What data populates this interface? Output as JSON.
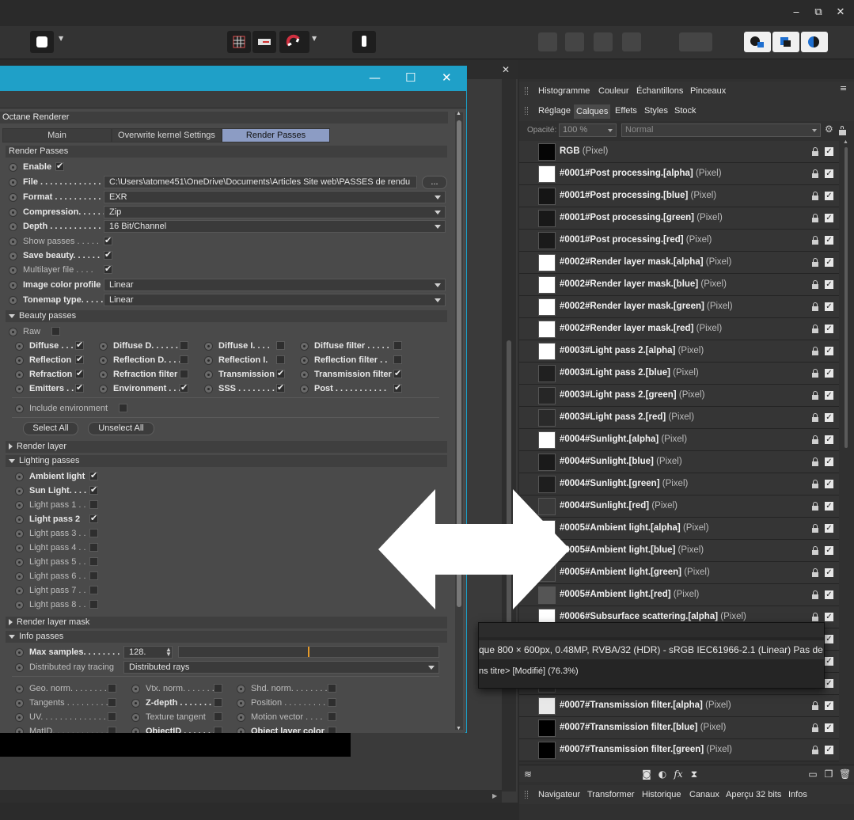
{
  "window": {
    "minimize": "‒",
    "restore": "⧉",
    "close": "✕"
  },
  "plugin_window": {
    "minimize": "—",
    "maximize": "☐",
    "close": "✕",
    "section_title": "Octane Renderer",
    "tabs": [
      "Main",
      "Overwrite kernel Settings",
      "Render Passes"
    ],
    "active_tab": "Render Passes",
    "render_passes_header": "Render Passes",
    "enable": {
      "label": "Enable",
      "checked": true
    },
    "file": {
      "label": "File . . . . . . . . . . . . .",
      "value": "C:\\Users\\atome451\\OneDrive\\Documents\\Articles Site web\\PASSES de rendu",
      "browse": "..."
    },
    "format": {
      "label": "Format . . . . . . . . . .",
      "value": "EXR"
    },
    "compression": {
      "label": "Compression. . . . . . .",
      "value": "Zip"
    },
    "depth": {
      "label": "Depth . . . . . . . . . . .",
      "value": "16 Bit/Channel"
    },
    "show_passes": {
      "label": "Show passes . . . . .",
      "checked": true
    },
    "save_beauty": {
      "label": "Save beauty. . . . . .",
      "checked": true
    },
    "multilayer_file": {
      "label": "Multilayer file . . . .",
      "checked": true
    },
    "image_color_profile": {
      "label": "Image color profile",
      "value": "Linear"
    },
    "tonemap_type": {
      "label": "Tonemap type. . . . .",
      "value": "Linear"
    },
    "beauty_passes": {
      "header": "Beauty passes",
      "raw": "Raw",
      "col1": [
        {
          "label": "Diffuse . . . .",
          "checked": true
        },
        {
          "label": "Reflection",
          "checked": true
        },
        {
          "label": "Refraction",
          "checked": true
        },
        {
          "label": "Emitters . .",
          "checked": true
        }
      ],
      "col2": [
        {
          "label": "Diffuse D. . . . . .",
          "checked": false
        },
        {
          "label": "Reflection D. . . .",
          "checked": false
        },
        {
          "label": "Refraction filter",
          "checked": false
        },
        {
          "label": "Environment . . .",
          "checked": true
        }
      ],
      "col3": [
        {
          "label": "Diffuse I. . . .",
          "checked": false
        },
        {
          "label": "Reflection I.",
          "checked": false
        },
        {
          "label": "Transmission",
          "checked": true
        },
        {
          "label": "SSS . . . . . . . .",
          "checked": true
        }
      ],
      "col4": [
        {
          "label": "Diffuse filter . . . . .",
          "checked": false
        },
        {
          "label": "Reflection filter . .",
          "checked": false
        },
        {
          "label": "Transmission filter",
          "checked": true
        },
        {
          "label": "Post . . . . . . . . . . .",
          "checked": true
        }
      ],
      "include_environment": "Include environment",
      "select_all": "Select All",
      "unselect_all": "Unselect All"
    },
    "render_layer": "Render layer",
    "lighting_passes": {
      "header": "Lighting passes",
      "items": [
        {
          "label": "Ambient light",
          "checked": true,
          "bold": true
        },
        {
          "label": "Sun Light. . . .",
          "checked": true,
          "bold": true
        },
        {
          "label": "Light pass 1 . .",
          "checked": false,
          "bold": false
        },
        {
          "label": "Light pass 2",
          "checked": true,
          "bold": true
        },
        {
          "label": "Light pass 3 . .",
          "checked": false,
          "bold": false
        },
        {
          "label": "Light pass 4 . .",
          "checked": false,
          "bold": false
        },
        {
          "label": "Light pass 5 . .",
          "checked": false,
          "bold": false
        },
        {
          "label": "Light pass 6 . .",
          "checked": false,
          "bold": false
        },
        {
          "label": "Light pass 7 . .",
          "checked": false,
          "bold": false
        },
        {
          "label": "Light pass 8 . .",
          "checked": false,
          "bold": false
        }
      ]
    },
    "render_layer_mask": "Render layer mask",
    "info_passes": {
      "header": "Info passes",
      "max_samples": {
        "label": "Max samples. . . . . . . .",
        "value": "128.",
        "slider_fraction": 0.5
      },
      "distributed_ray_tracing": {
        "label": "Distributed ray tracing",
        "value": "Distributed rays"
      },
      "col1": [
        "Geo. norm. . . . . . . .",
        "Tangents . . . . . . . . .",
        "UV. . . . . . . . . . . . . .",
        "MatID. . . . . . . . . . . ."
      ],
      "col2": [
        "Vtx. norm. . . . . . .",
        "Z-depth . . . . . . . . .",
        "Texture tangent",
        "ObjectID . . . . . . . ."
      ],
      "col3": [
        "Shd. norm. . . . . . . .",
        "Position . . . . . . . . .",
        "Motion vector . . . .",
        "Object layer color"
      ]
    }
  },
  "panel": {
    "tabs_row1": [
      "Histogramme",
      "Couleur",
      "Échantillons",
      "Pinceaux"
    ],
    "tabs_row2": [
      "Réglage",
      "Calques",
      "Effets",
      "Styles",
      "Stock"
    ],
    "active_tab": "Calques",
    "opacity_label": "Opacité:",
    "opacity_value": "100 %",
    "blend_mode": "Normal",
    "layers": [
      {
        "name": "RGB",
        "type": "(Pixel)",
        "thumb": "#050505"
      },
      {
        "name": "#0001#Post processing.[alpha]",
        "type": "(Pixel)",
        "thumb": "#ffffff"
      },
      {
        "name": "#0001#Post processing.[blue]",
        "type": "(Pixel)",
        "thumb": "#151515"
      },
      {
        "name": "#0001#Post processing.[green]",
        "type": "(Pixel)",
        "thumb": "#181818"
      },
      {
        "name": "#0001#Post processing.[red]",
        "type": "(Pixel)",
        "thumb": "#1a1a1a"
      },
      {
        "name": "#0002#Render layer mask.[alpha]",
        "type": "(Pixel)",
        "thumb": "#ffffff"
      },
      {
        "name": "#0002#Render layer mask.[blue]",
        "type": "(Pixel)",
        "thumb": "#ffffff"
      },
      {
        "name": "#0002#Render layer mask.[green]",
        "type": "(Pixel)",
        "thumb": "#ffffff"
      },
      {
        "name": "#0002#Render layer mask.[red]",
        "type": "(Pixel)",
        "thumb": "#ffffff"
      },
      {
        "name": "#0003#Light pass 2.[alpha]",
        "type": "(Pixel)",
        "thumb": "#ffffff"
      },
      {
        "name": "#0003#Light pass 2.[blue]",
        "type": "(Pixel)",
        "thumb": "#202020"
      },
      {
        "name": "#0003#Light pass 2.[green]",
        "type": "(Pixel)",
        "thumb": "#262626"
      },
      {
        "name": "#0003#Light pass 2.[red]",
        "type": "(Pixel)",
        "thumb": "#2a2a2a"
      },
      {
        "name": "#0004#Sunlight.[alpha]",
        "type": "(Pixel)",
        "thumb": "#ffffff"
      },
      {
        "name": "#0004#Sunlight.[blue]",
        "type": "(Pixel)",
        "thumb": "#1a1a1a"
      },
      {
        "name": "#0004#Sunlight.[green]",
        "type": "(Pixel)",
        "thumb": "#1e1e1e"
      },
      {
        "name": "#0004#Sunlight.[red]",
        "type": "(Pixel)",
        "thumb": "#3a3a3a"
      },
      {
        "name": "#0005#Ambient light.[alpha]",
        "type": "(Pixel)",
        "thumb": "#ffffff"
      },
      {
        "name": "#0005#Ambient light.[blue]",
        "type": "(Pixel)",
        "thumb": "#2a2a2a"
      },
      {
        "name": "#0005#Ambient light.[green]",
        "type": "(Pixel)",
        "thumb": "#3a3a3a"
      },
      {
        "name": "#0005#Ambient light.[red]",
        "type": "(Pixel)",
        "thumb": "#555555"
      },
      {
        "name": "#0006#Subsurface scattering.[alpha]",
        "type": "(Pixel)",
        "thumb": "#ffffff"
      },
      {
        "name": "",
        "type": "",
        "thumb": "#303030"
      },
      {
        "name": "",
        "type": "",
        "thumb": "#303030"
      },
      {
        "name": "",
        "type": "",
        "thumb": "#303030"
      },
      {
        "name": "#0007#Transmission filter.[alpha]",
        "type": "(Pixel)",
        "thumb": "#e8e8e8"
      },
      {
        "name": "#0007#Transmission filter.[blue]",
        "type": "(Pixel)",
        "thumb": "#000000"
      },
      {
        "name": "#0007#Transmission filter.[green]",
        "type": "(Pixel)",
        "thumb": "#000000"
      }
    ],
    "bottom_tabs": [
      "Navigateur",
      "Transformer",
      "Historique",
      "Canaux",
      "Aperçu 32 bits",
      "Infos"
    ]
  },
  "status_popup": {
    "line1": "que    800 × 600px, 0.48MP, RVBA/32 (HDR) - sRGB IEC61966-2.1 (Linear)     Pas de",
    "line2": "ns titre> [Modifié] (76.3%)"
  },
  "colors": {
    "accent": "#1fa0c8",
    "active_tab": "#8c9cc4"
  }
}
